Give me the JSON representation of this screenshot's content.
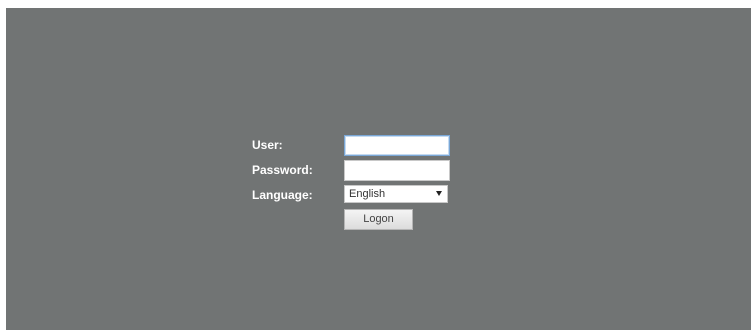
{
  "login": {
    "user_label": "User:",
    "user_value": "",
    "password_label": "Password:",
    "password_value": "",
    "language_label": "Language:",
    "language_selected": "English",
    "logon_label": "Logon"
  },
  "colors": {
    "background": "#717474",
    "label_text": "#ffffff",
    "focus_border": "#7aa7d6"
  },
  "icons": {
    "language_dropdown": "chevron-down-icon"
  }
}
